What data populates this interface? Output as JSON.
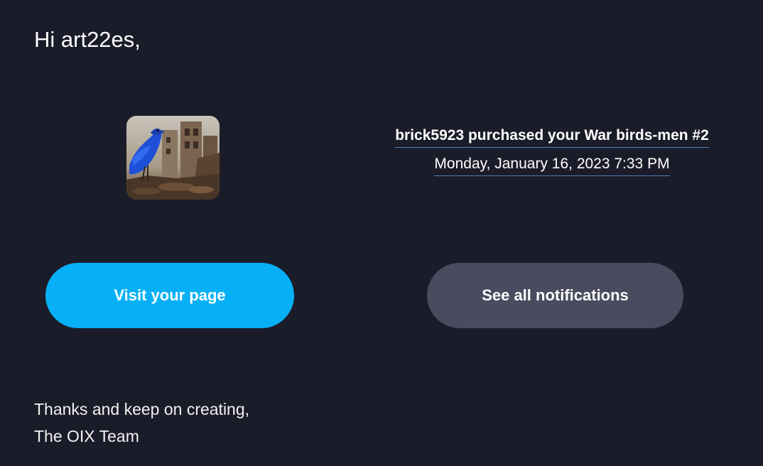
{
  "email": {
    "greeting": "Hi art22es,",
    "notification": {
      "title": "brick5923 purchased your War birds-men #2",
      "timestamp": "Monday, January 16, 2023 7:33 PM",
      "thumbnail_icon": "artwork-thumbnail-blue-bird"
    },
    "buttons": {
      "visit_label": "Visit your page",
      "notifications_label": "See all notifications"
    },
    "signoff": {
      "line1": "Thanks and keep on creating,",
      "line2": "The OIX Team"
    }
  },
  "colors": {
    "background": "#1b1c29",
    "primary_button": "#07b0f6",
    "secondary_button": "#4a4b5e",
    "link_underline": "#4a7fc3"
  }
}
